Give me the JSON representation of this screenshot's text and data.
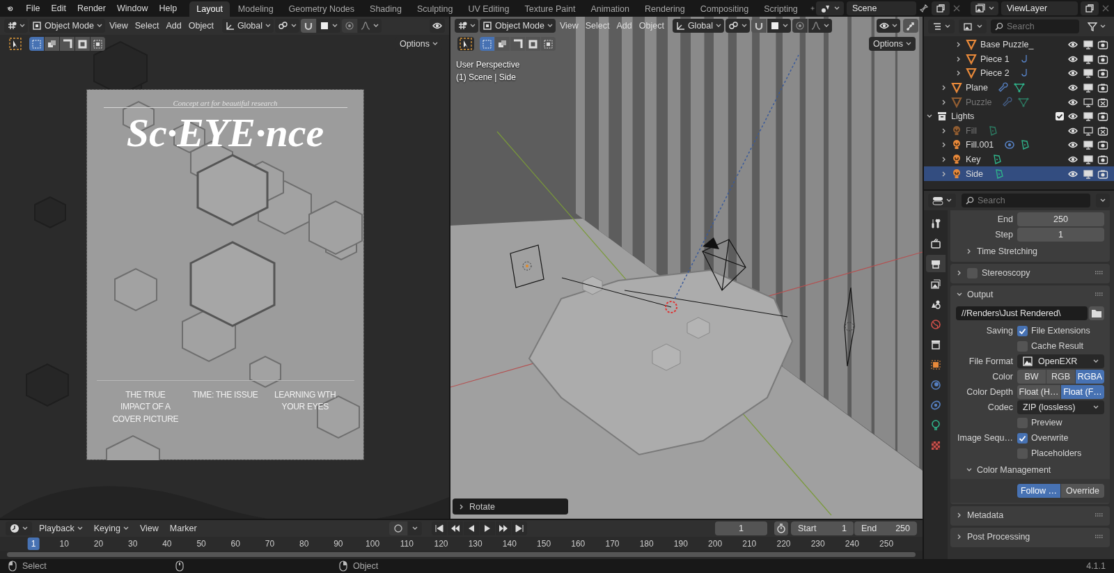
{
  "app_menu": [
    "File",
    "Edit",
    "Render",
    "Window",
    "Help"
  ],
  "workspaces": [
    {
      "label": "Layout",
      "selected": true
    },
    {
      "label": "Modeling",
      "selected": false
    },
    {
      "label": "Geometry Nodes",
      "selected": false
    },
    {
      "label": "Shading",
      "selected": false
    },
    {
      "label": "Sculpting",
      "selected": false
    },
    {
      "label": "UV Editing",
      "selected": false
    },
    {
      "label": "Texture Paint",
      "selected": false
    },
    {
      "label": "Animation",
      "selected": false
    },
    {
      "label": "Rendering",
      "selected": false
    },
    {
      "label": "Compositing",
      "selected": false
    },
    {
      "label": "Scripting",
      "selected": false
    }
  ],
  "scene": {
    "name": "Scene"
  },
  "view_layer": {
    "name": "ViewLayer"
  },
  "viewports": [
    {
      "kind": "camera",
      "mode": "Object Mode",
      "menus": [
        "View",
        "Select",
        "Add",
        "Object"
      ],
      "orientation": "Global",
      "options": "Options",
      "cover": {
        "tagline": "Concept art for beautiful research",
        "title": "Sc·EYE·nce",
        "headlines": [
          "THE TRUE IMPACT OF A COVER PICTURE",
          "TIME: THE ISSUE",
          "LEARNING WTH YOUR EYES"
        ]
      }
    },
    {
      "kind": "perspective",
      "mode": "Object Mode",
      "menus": [
        "View",
        "Select",
        "Add",
        "Object"
      ],
      "orientation": "Global",
      "options": "Options",
      "view_name": "User Perspective",
      "view_info": "(1) Scene | Side",
      "last_operator": "Rotate"
    }
  ],
  "outliner": {
    "search": {
      "placeholder": "Search"
    },
    "items": [
      {
        "children": [
          {
            "children": [
              {
                "label": "Base Puzzle_",
                "kind": "mesh",
                "expanded": false,
                "selected": false,
                "disabled": false
              },
              {
                "label": "Piece 1",
                "kind": "mesh",
                "expanded": false,
                "selected": false,
                "disabled": false,
                "extras": [
                  {
                    "kind": "hook"
                  }
                ]
              },
              {
                "label": "Piece 2",
                "kind": "mesh",
                "expanded": false,
                "selected": false,
                "disabled": false,
                "extras": [
                  {
                    "kind": "hook"
                  }
                ]
              }
            ]
          },
          {
            "label": "Plane",
            "kind": "mesh",
            "expanded": false,
            "selected": false,
            "disabled": false,
            "extras": [
              {
                "kind": "modifier"
              },
              {
                "kind": "mesh_data"
              }
            ]
          },
          {
            "label": "Puzzle",
            "kind": "mesh",
            "expanded": false,
            "selected": false,
            "disabled": true,
            "extras": [
              {
                "kind": "modifier"
              },
              {
                "kind": "mesh_data"
              }
            ]
          }
        ]
      },
      {
        "label": "Lights",
        "kind": "collection",
        "expanded": true,
        "selected": false,
        "disabled": false,
        "checked": true,
        "children": [
          {
            "label": "Fill",
            "kind": "light",
            "expanded": false,
            "selected": false,
            "disabled": true,
            "extras": [
              {
                "kind": "light_data"
              }
            ]
          },
          {
            "label": "Fill.001",
            "kind": "light",
            "expanded": false,
            "selected": false,
            "disabled": false,
            "extras": [
              {
                "kind": "constraint"
              },
              {
                "kind": "light_data"
              }
            ]
          },
          {
            "label": "Key",
            "kind": "light",
            "expanded": false,
            "selected": false,
            "disabled": false,
            "extras": [
              {
                "kind": "light_data"
              }
            ]
          },
          {
            "label": "Side",
            "kind": "light",
            "expanded": false,
            "selected": true,
            "disabled": false,
            "extras": [
              {
                "kind": "light_data"
              }
            ]
          }
        ]
      }
    ]
  },
  "properties": {
    "search": {
      "placeholder": "Search"
    },
    "tabs": [
      {
        "kind": "tool",
        "selected": false
      },
      {
        "kind": "render",
        "selected": false
      },
      {
        "kind": "output",
        "selected": true
      },
      {
        "kind": "view_layer",
        "selected": false
      },
      {
        "kind": "scene",
        "selected": false
      },
      {
        "kind": "world",
        "selected": false
      },
      {
        "kind": "collection",
        "selected": false
      },
      {
        "kind": "object",
        "selected": false
      },
      {
        "kind": "physics",
        "selected": false
      },
      {
        "kind": "constraint",
        "selected": false
      },
      {
        "kind": "light",
        "selected": false
      },
      {
        "kind": "texture",
        "selected": false
      }
    ],
    "panels": [
      {
        "rows": [
          {
            "kind": "number",
            "label": "End",
            "value": "250"
          },
          {
            "kind": "number",
            "label": "Step",
            "value": "1"
          },
          {
            "kind": "subpanel",
            "title": "Time Stretching",
            "expanded": false
          }
        ]
      },
      {
        "title": "Stereoscopy",
        "expanded": false,
        "checked": false
      },
      {
        "title": "Output",
        "expanded": true,
        "rows": [
          {
            "kind": "path",
            "value": "//Renders\\Just Rendered\\"
          },
          {
            "kind": "check",
            "label": "Saving",
            "text": "File Extensions",
            "checked": true
          },
          {
            "kind": "check",
            "text": "Cache Result",
            "checked": false
          },
          {
            "kind": "format",
            "label": "File Format",
            "value": "OpenEXR"
          },
          {
            "kind": "segmented",
            "label": "Color",
            "options": [
              {
                "label": "BW",
                "selected": false
              },
              {
                "label": "RGB",
                "selected": false
              },
              {
                "label": "RGBA",
                "selected": true
              }
            ]
          },
          {
            "kind": "segmented",
            "label": "Color Depth",
            "options": [
              {
                "label": "Float (H…",
                "selected": false
              },
              {
                "label": "Float (F…",
                "selected": true
              }
            ]
          },
          {
            "kind": "dropdown",
            "label": "Codec",
            "value": "ZIP (lossless)"
          },
          {
            "kind": "check",
            "text": "Preview",
            "checked": false
          },
          {
            "kind": "check",
            "label": "Image Sequ…",
            "text": "Overwrite",
            "checked": true
          },
          {
            "kind": "check",
            "text": "Placeholders",
            "checked": false
          },
          {
            "kind": "subpanel",
            "title": "Color Management",
            "expanded": true,
            "rows": [
              {
                "kind": "segmented",
                "options": [
                  {
                    "label": "Follow …",
                    "selected": true
                  },
                  {
                    "label": "Override",
                    "selected": false
                  }
                ]
              }
            ]
          }
        ]
      },
      {
        "title": "Metadata",
        "expanded": false
      },
      {
        "title": "Post Processing",
        "expanded": false
      }
    ]
  },
  "timeline": {
    "menus": [
      "Playback",
      "Keying",
      "View",
      "Marker"
    ],
    "current_frame": "1",
    "start": {
      "label": "Start",
      "value": "1"
    },
    "end": {
      "label": "End",
      "value": "250"
    },
    "ruler": [
      {
        "label": "1",
        "selected": true
      },
      {
        "label": "10",
        "selected": false
      },
      {
        "label": "20",
        "selected": false
      },
      {
        "label": "30",
        "selected": false
      },
      {
        "label": "40",
        "selected": false
      },
      {
        "label": "50",
        "selected": false
      },
      {
        "label": "60",
        "selected": false
      },
      {
        "label": "70",
        "selected": false
      },
      {
        "label": "80",
        "selected": false
      },
      {
        "label": "90",
        "selected": false
      },
      {
        "label": "100",
        "selected": false
      },
      {
        "label": "110",
        "selected": false
      },
      {
        "label": "120",
        "selected": false
      },
      {
        "label": "130",
        "selected": false
      },
      {
        "label": "140",
        "selected": false
      },
      {
        "label": "150",
        "selected": false
      },
      {
        "label": "160",
        "selected": false
      },
      {
        "label": "170",
        "selected": false
      },
      {
        "label": "180",
        "selected": false
      },
      {
        "label": "190",
        "selected": false
      },
      {
        "label": "200",
        "selected": false
      },
      {
        "label": "210",
        "selected": false
      },
      {
        "label": "220",
        "selected": false
      },
      {
        "label": "230",
        "selected": false
      },
      {
        "label": "240",
        "selected": false
      },
      {
        "label": "250",
        "selected": false
      }
    ]
  },
  "status_bar": {
    "items": [
      {
        "kind": "left_mouse",
        "label": "Select"
      },
      {
        "kind": "middle_mouse"
      },
      {
        "kind": "right_mouse",
        "label": "Object"
      }
    ],
    "version": "4.1.1"
  }
}
